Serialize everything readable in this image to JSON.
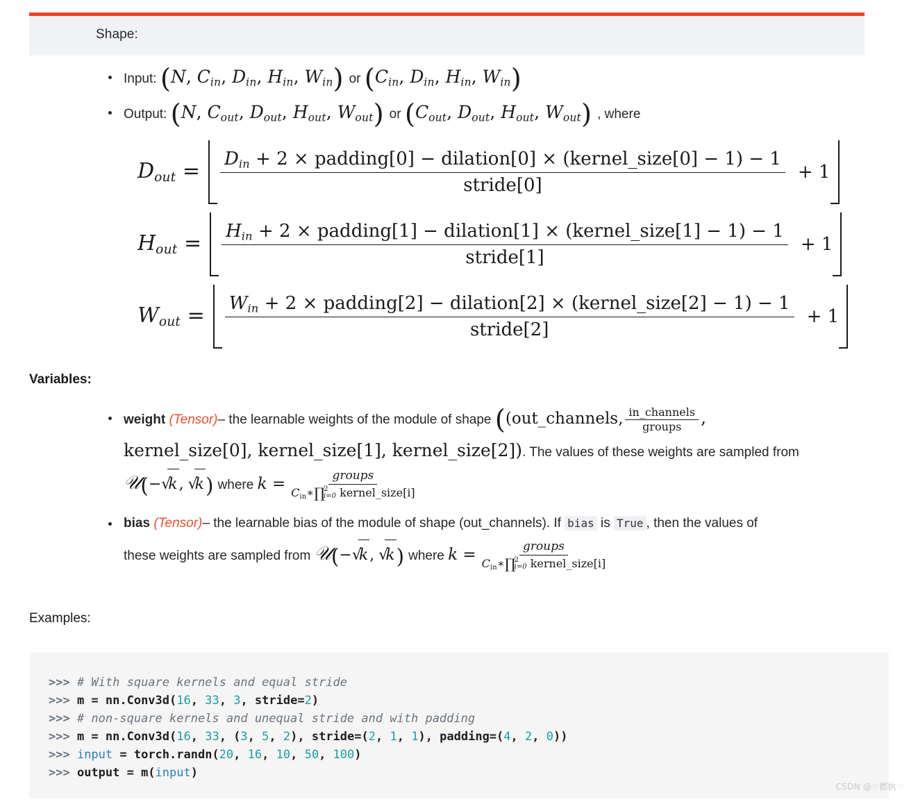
{
  "admonition": {
    "title": "Shape:",
    "accent_color": "#ee4323",
    "background_color": "#f0f2f6"
  },
  "shape_bullets": [
    {
      "label": "Input:",
      "tuple_1": [
        "N",
        "C",
        "in",
        "D",
        "in",
        "H",
        "in",
        "W",
        "in"
      ],
      "conjunction": "or",
      "tuple_2": [
        "C",
        "in",
        "D",
        "in",
        "H",
        "in",
        "W",
        "in"
      ],
      "trailing": ""
    },
    {
      "label": "Output:",
      "tuple_1": [
        "N",
        "C",
        "out",
        "D",
        "out",
        "H",
        "out",
        "W",
        "out"
      ],
      "conjunction": "or",
      "tuple_2": [
        "C",
        "out",
        "D",
        "out",
        "H",
        "out",
        "W",
        "out"
      ],
      "trailing": ", where"
    }
  ],
  "formulas": [
    {
      "lhs_var": "D",
      "lhs_sub": "out",
      "equals": "=",
      "numerator": "D_in + 2 × padding[0] − dilation[0] × (kernel_size[0] − 1) − 1",
      "num_var": "D",
      "num_var_sub": "in",
      "num_rest": " + 2 × padding[0] − dilation[0] × (kernel_size[0] − 1) − 1",
      "denominator": "stride[0]",
      "plus_one": "+ 1"
    },
    {
      "lhs_var": "H",
      "lhs_sub": "out",
      "equals": "=",
      "numerator": "H_in + 2 × padding[1] − dilation[1] × (kernel_size[1] − 1) − 1",
      "num_var": "H",
      "num_var_sub": "in",
      "num_rest": " + 2 × padding[1] − dilation[1] × (kernel_size[1] − 1) − 1",
      "denominator": "stride[1]",
      "plus_one": "+ 1"
    },
    {
      "lhs_var": "W",
      "lhs_sub": "out",
      "equals": "=",
      "numerator": "W_in + 2 × padding[2] − dilation[2] × (kernel_size[2] − 1) − 1",
      "num_var": "W",
      "num_var_sub": "in",
      "num_rest": " + 2 × padding[2] − dilation[2] × (kernel_size[2] − 1) − 1",
      "denominator": "stride[2]",
      "plus_one": "+ 1"
    }
  ],
  "variables": {
    "heading": "Variables:",
    "weight": {
      "name": "weight",
      "type": "(Tensor)",
      "dash": "–",
      "desc_1": "the learnable weights of the module of shape",
      "shape_open": "(out_channels,",
      "ic_num": "in_channels",
      "ic_den": "groups",
      "shape_comma": ",",
      "shape_rest": "kernel_size[0], kernel_size[1], kernel_size[2])",
      "desc_2": ". The values of these weights are sampled from",
      "dist_open": "−",
      "where": "where",
      "k_var": "k",
      "equals": "=",
      "k_num": "groups",
      "k_den_prefix": "C",
      "k_den_sub": "in",
      "k_den_star": "∗",
      "k_den_prod_upper": "2",
      "k_den_prod_lower": "i=0",
      "k_den_rest": "kernel_size[i]"
    },
    "bias": {
      "name": "bias",
      "type": "(Tensor)",
      "dash": "–",
      "desc_1": "the learnable bias of the module of shape (out_channels). If",
      "code_bias": "bias",
      "is_word": "is",
      "code_true": "True",
      "desc_2": ", then the values of",
      "desc_3": "these weights are sampled from",
      "where": "where",
      "k_var": "k",
      "equals": "=",
      "k_num": "groups",
      "k_den_prefix": "C",
      "k_den_sub": "in",
      "k_den_star": "∗",
      "k_den_prod_upper": "2",
      "k_den_prod_lower": "i=0",
      "k_den_rest": "kernel_size[i]"
    }
  },
  "examples": {
    "heading": "Examples:",
    "lines": [
      {
        "prompt": ">>> ",
        "tokens": [
          {
            "t": "comment",
            "v": "# With square kernels and equal stride"
          }
        ]
      },
      {
        "prompt": ">>> ",
        "tokens": [
          {
            "t": "plain",
            "v": "m = nn.Conv3d("
          },
          {
            "t": "num",
            "v": "16"
          },
          {
            "t": "plain",
            "v": ", "
          },
          {
            "t": "num",
            "v": "33"
          },
          {
            "t": "plain",
            "v": ", "
          },
          {
            "t": "num",
            "v": "3"
          },
          {
            "t": "plain",
            "v": ", stride="
          },
          {
            "t": "num",
            "v": "2"
          },
          {
            "t": "plain",
            "v": ")"
          }
        ]
      },
      {
        "prompt": ">>> ",
        "tokens": [
          {
            "t": "comment",
            "v": "# non-square kernels and unequal stride and with padding"
          }
        ]
      },
      {
        "prompt": ">>> ",
        "tokens": [
          {
            "t": "plain",
            "v": "m = nn.Conv3d("
          },
          {
            "t": "num",
            "v": "16"
          },
          {
            "t": "plain",
            "v": ", "
          },
          {
            "t": "num",
            "v": "33"
          },
          {
            "t": "plain",
            "v": ", ("
          },
          {
            "t": "num",
            "v": "3"
          },
          {
            "t": "plain",
            "v": ", "
          },
          {
            "t": "num",
            "v": "5"
          },
          {
            "t": "plain",
            "v": ", "
          },
          {
            "t": "num",
            "v": "2"
          },
          {
            "t": "plain",
            "v": "), stride=("
          },
          {
            "t": "num",
            "v": "2"
          },
          {
            "t": "plain",
            "v": ", "
          },
          {
            "t": "num",
            "v": "1"
          },
          {
            "t": "plain",
            "v": ", "
          },
          {
            "t": "num",
            "v": "1"
          },
          {
            "t": "plain",
            "v": "), padding=("
          },
          {
            "t": "num",
            "v": "4"
          },
          {
            "t": "plain",
            "v": ", "
          },
          {
            "t": "num",
            "v": "2"
          },
          {
            "t": "plain",
            "v": ", "
          },
          {
            "t": "num",
            "v": "0"
          },
          {
            "t": "plain",
            "v": "))"
          }
        ]
      },
      {
        "prompt": ">>> ",
        "tokens": [
          {
            "t": "builtin",
            "v": "input"
          },
          {
            "t": "plain",
            "v": " = torch.randn("
          },
          {
            "t": "num",
            "v": "20"
          },
          {
            "t": "plain",
            "v": ", "
          },
          {
            "t": "num",
            "v": "16"
          },
          {
            "t": "plain",
            "v": ", "
          },
          {
            "t": "num",
            "v": "10"
          },
          {
            "t": "plain",
            "v": ", "
          },
          {
            "t": "num",
            "v": "50"
          },
          {
            "t": "plain",
            "v": ", "
          },
          {
            "t": "num",
            "v": "100"
          },
          {
            "t": "plain",
            "v": ")"
          }
        ]
      },
      {
        "prompt": ">>> ",
        "tokens": [
          {
            "t": "plain",
            "v": "output = m("
          },
          {
            "t": "builtin",
            "v": "input"
          },
          {
            "t": "plain",
            "v": ")"
          }
        ]
      }
    ]
  },
  "watermark": "CSDN @☞郡执☜"
}
